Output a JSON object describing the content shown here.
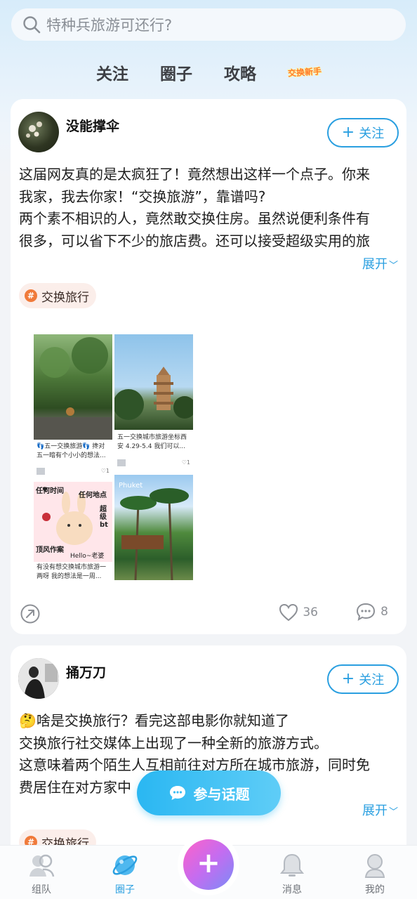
{
  "search": {
    "placeholder": "特种兵旅游可还行?"
  },
  "tabs": [
    {
      "label": "关注"
    },
    {
      "label": "圈子"
    },
    {
      "label": "攻略"
    },
    {
      "label": "交换新手"
    }
  ],
  "posts": [
    {
      "username": "没能撑伞",
      "follow_label": "关注",
      "text_lines": [
        "这届网友真的是太疯狂了！竟然想出这样一个点子。你来",
        "我家，我去你家！“交换旅游”，靠谱吗?",
        "两个素不相识的人，竟然敢交换住房。虽然说便利条件有",
        "很多，可以省下不少的旅店费。还可以接受超级实用的旅"
      ],
      "expand_label": "展开",
      "topic": "交换旅行",
      "images": [
        {
          "caption": "👣五一交换旅游👣 搀对五一暗有个小小的想法...",
          "likes": "1"
        },
        {
          "caption": "五一交换城市旅游坐标西安 4.29-5.4 我们可以...",
          "likes": "1"
        },
        {
          "caption": "有没有想交换城市旅游一两呀 我的想法是一周...",
          "overlay": [
            "任何时间",
            "任何地点",
            "超级bt",
            "顶风作案",
            "Hello~老婆"
          ]
        },
        {
          "caption": "",
          "overlay": [
            "Phuket"
          ]
        }
      ],
      "likes": "36",
      "comments": "8"
    },
    {
      "username": "捅万刀",
      "follow_label": "关注",
      "text_lines": [
        "🤔啥是交换旅行？看完这部电影你就知道了",
        "交换旅行社交媒体上出现了一种全新的旅游方式。",
        "这意味着两个陌生人互相前往对方所在城市旅游，同时免",
        "费居住在对方家中"
      ],
      "expand_label": "展开",
      "topic": "交换旅行"
    }
  ],
  "join_button": {
    "label": "参与话题"
  },
  "bottom_nav": [
    {
      "label": "组队",
      "icon": "team-icon"
    },
    {
      "label": "圈子",
      "icon": "planet-icon",
      "active": true
    },
    {
      "label": "",
      "icon": "plus-icon"
    },
    {
      "label": "消息",
      "icon": "bell-icon"
    },
    {
      "label": "我的",
      "icon": "profile-icon"
    }
  ],
  "colors": {
    "accent": "#2a9fe0",
    "join_button": "#2ab7f2",
    "topic_hash": "#f07a3a"
  }
}
